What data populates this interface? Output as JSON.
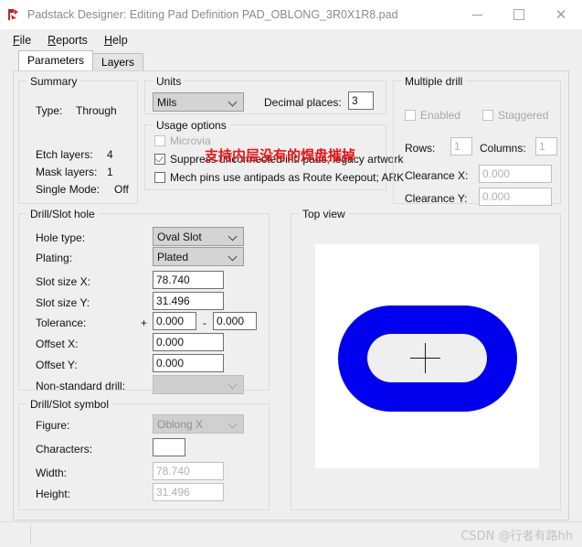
{
  "window": {
    "title": "Padstack Designer: Editing Pad Definition PAD_OBLONG_3R0X1R8.pad",
    "app_icon": "padstack-app-icon",
    "minimize_label": "—",
    "maximize_label": "",
    "close_label": "✕",
    "accent_pad_color": "#0000ee",
    "annotation_color": "#ee1111"
  },
  "menu": {
    "items": [
      {
        "label": "File",
        "mnemonic": "F"
      },
      {
        "label": "Reports",
        "mnemonic": "R"
      },
      {
        "label": "Help",
        "mnemonic": "H"
      }
    ]
  },
  "tabs": [
    {
      "label": "Parameters",
      "active": true
    },
    {
      "label": "Layers",
      "active": false
    }
  ],
  "summary": {
    "legend": "Summary",
    "rows": [
      {
        "label": "Type:",
        "value": "Through"
      },
      {
        "label": "Etch layers:",
        "value": "4"
      },
      {
        "label": "Mask layers:",
        "value": "1"
      },
      {
        "label": "Single Mode:",
        "value": "Off"
      }
    ]
  },
  "units": {
    "legend": "Units",
    "unit_value": "Mils",
    "decimal_places_label": "Decimal places:",
    "decimal_places_value": "3"
  },
  "usage_options": {
    "legend": "Usage options",
    "microvia": {
      "label": "Microvia",
      "checked": false,
      "enabled": false
    },
    "suppress": {
      "label": "Suppress unconnected int. pads; legacy artwork",
      "checked": true,
      "enabled": true
    },
    "mech_pins": {
      "label": "Mech pins use antipads as Route Keepout; ARK",
      "checked": false,
      "enabled": true
    }
  },
  "annotation": {
    "text": "支持内层没有的焊盘摧掉"
  },
  "multiple_drill": {
    "legend": "Multiple drill",
    "enabled_label": "Enabled",
    "staggered_label": "Staggered",
    "rows_label": "Rows:",
    "rows_value": "1",
    "columns_label": "Columns:",
    "columns_value": "1",
    "clearance_x_label": "Clearance X:",
    "clearance_x_value": "0.000",
    "clearance_y_label": "Clearance Y:",
    "clearance_y_value": "0.000"
  },
  "drill_slot_hole": {
    "legend": "Drill/Slot hole",
    "hole_type_label": "Hole type:",
    "hole_type_value": "Oval Slot",
    "plating_label": "Plating:",
    "plating_value": "Plated",
    "slot_size_x_label": "Slot size X:",
    "slot_size_x_value": "78.740",
    "slot_size_y_label": "Slot size Y:",
    "slot_size_y_value": "31.496",
    "tolerance_label": "Tolerance:",
    "tolerance_plus_sign": "+",
    "tolerance_plus_value": "0.000",
    "tolerance_separator": "-",
    "tolerance_minus_value": "0.000",
    "offset_x_label": "Offset X:",
    "offset_x_value": "0.000",
    "offset_y_label": "Offset Y:",
    "offset_y_value": "0.000",
    "non_standard_drill_label": "Non-standard drill:",
    "non_standard_drill_value": ""
  },
  "drill_slot_symbol": {
    "legend": "Drill/Slot symbol",
    "figure_label": "Figure:",
    "figure_value": "Oblong X",
    "characters_label": "Characters:",
    "characters_value": "",
    "width_label": "Width:",
    "width_value": "78.740",
    "height_label": "Height:",
    "height_value": "31.496"
  },
  "top_view": {
    "legend": "Top view"
  },
  "statusbar": {
    "text": "",
    "watermark": "CSDN @行者有路hh"
  }
}
